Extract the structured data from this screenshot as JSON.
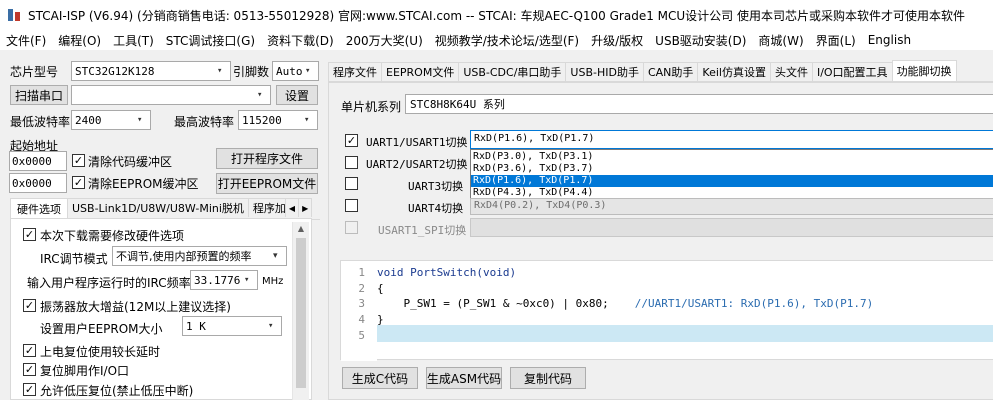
{
  "window": {
    "title": "STCAI-ISP (V6.94) (分销商销售电话: 0513-55012928) 官网:www.STCAI.com  -- STCAI: 车规AEC-Q100 Grade1 MCU设计公司 使用本司芯片或采购本软件才可使用本软件"
  },
  "menu": [
    "文件(F)",
    "编程(O)",
    "工具(T)",
    "STC调试接口(G)",
    "资料下载(D)",
    "200万大奖(U)",
    "视频教学/技术论坛/选型(F)",
    "升级/版权",
    "USB驱动安装(D)",
    "商城(W)",
    "界面(L)",
    "English"
  ],
  "left": {
    "chip_label": "芯片型号",
    "chip_value": "STC32G12K128",
    "baud_label": "引脚数",
    "baud_value": "Auto",
    "scan_button": "扫描串口",
    "port_value": "",
    "settings_button": "设置",
    "min_baud_label": "最低波特率",
    "min_baud_value": "2400",
    "max_baud_label": "最高波特率",
    "max_baud_value": "115200",
    "start_addr_label": "起始地址",
    "addr1": "0x0000",
    "addr2": "0x0000",
    "clear_code_label": "清除代码缓冲区",
    "clear_eeprom_label": "清除EEPROM缓冲区",
    "open_prog_button": "打开程序文件",
    "open_eeprom_button": "打开EEPROM文件",
    "tabs": [
      "硬件选项",
      "USB-Link1D/U8W/U8W-Mini脱机",
      "程序加"
    ],
    "options": {
      "modify_hw": "本次下载需要修改硬件选项",
      "irc_mode_label": "IRC调节模式",
      "irc_mode_value": "不调节,使用内部预置的频率",
      "irc_freq_label": "输入用户程序运行时的IRC频率",
      "irc_freq_value": "33.1776",
      "irc_unit": "MHz",
      "osc_gain": "振荡器放大增益(12M以上建议选择)",
      "eeprom_label": "设置用户EEPROM大小",
      "eeprom_value": "1   K",
      "power_reset": "上电复位使用较长延时",
      "reset_io": "复位脚用作I/O口",
      "low_volt_reset": "允许低压复位(禁止低压中断)"
    }
  },
  "right": {
    "tabs": [
      "程序文件",
      "EEPROM文件",
      "USB-CDC/串口助手",
      "USB-HID助手",
      "CAN助手",
      "Keil仿真设置",
      "头文件",
      "I/O口配置工具",
      "功能脚切换"
    ],
    "series_label": "单片机系列",
    "series_value": "STC8H8K64U 系列",
    "switches": [
      {
        "label": "UART1/USART1切换",
        "checked": true,
        "value": "RxD(P1.6), TxD(P1.7)"
      },
      {
        "label": "UART2/USART2切换",
        "checked": false,
        "value": ""
      },
      {
        "label": "UART3切换",
        "checked": false,
        "value": ""
      },
      {
        "label": "UART4切换",
        "checked": false,
        "value": "RxD4(P0.2), TxD4(P0.3)"
      },
      {
        "label": "USART1_SPI切换",
        "checked": false,
        "value": ""
      }
    ],
    "dropdown_options": [
      "RxD(P3.0), TxD(P3.1)",
      "RxD(P3.6), TxD(P3.7)",
      "RxD(P1.6), TxD(P1.7)",
      "RxD(P4.3), TxD(P4.4)"
    ],
    "dropdown_selected": 2,
    "code_lines": [
      {
        "num": "1",
        "text": "void PortSwitch(void)"
      },
      {
        "num": "2",
        "text": "{"
      },
      {
        "num": "3",
        "text": "    P_SW1 = (P_SW1 & ~0xc0) | 0x80;",
        "comment": "//UART1/USART1: RxD(P1.6), TxD(P1.7)"
      },
      {
        "num": "4",
        "text": "}"
      },
      {
        "num": "5",
        "text": ""
      }
    ],
    "buttons": [
      "生成C代码",
      "生成ASM代码",
      "复制代码"
    ]
  },
  "colors": {
    "selection": "#0078d7",
    "code_highlight": "#cce8f4",
    "comment": "#2b6cb0"
  }
}
